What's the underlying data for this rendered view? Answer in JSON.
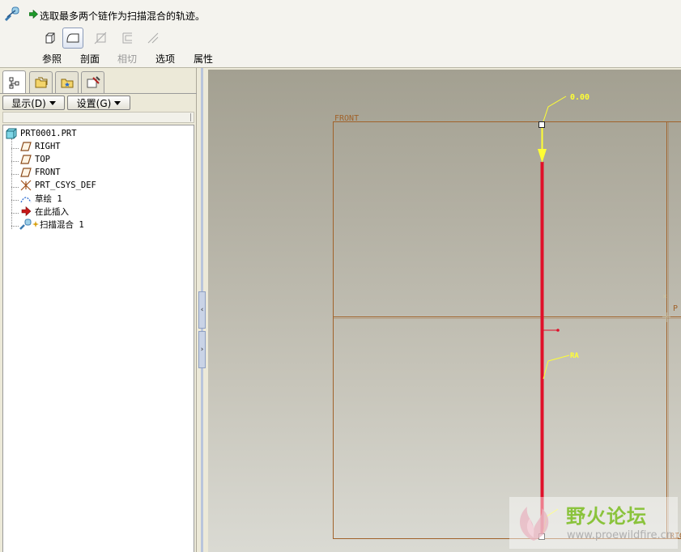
{
  "dashboard": {
    "prompt": "选取最多两个链作为扫描混合的轨迹。",
    "tabs": [
      {
        "label": "参照",
        "disabled": false
      },
      {
        "label": "剖面",
        "disabled": false
      },
      {
        "label": "相切",
        "disabled": true
      },
      {
        "label": "选项",
        "disabled": false
      },
      {
        "label": "属性",
        "disabled": false
      }
    ]
  },
  "left_panel": {
    "show_button": "显示(D)",
    "settings_button": "设置(G)",
    "tree": [
      {
        "label": "PRT0001.PRT",
        "icon": "part-icon"
      },
      {
        "label": "RIGHT",
        "icon": "datum-plane-icon"
      },
      {
        "label": "TOP",
        "icon": "datum-plane-icon"
      },
      {
        "label": "FRONT",
        "icon": "datum-plane-icon"
      },
      {
        "label": "PRT_CSYS_DEF",
        "icon": "csys-icon"
      },
      {
        "label": "草绘 1",
        "icon": "sketch-icon"
      },
      {
        "label": "在此插入",
        "icon": "insert-here-arrow-icon"
      },
      {
        "label": "扫描混合 1",
        "icon": "swept-blend-icon"
      }
    ]
  },
  "graphics": {
    "plane_label_front": "FRONT",
    "plane_label_top_partial": "P",
    "plane_label_right_partial": "RIG",
    "start_value": "0.00",
    "param_label": "RA"
  },
  "watermark": {
    "title": "野火论坛",
    "url": "www.proewildfire.cn"
  },
  "colors": {
    "trajectory": "#e0102a",
    "datum_plane": "#a0622a",
    "highlight": "#ffff33"
  }
}
